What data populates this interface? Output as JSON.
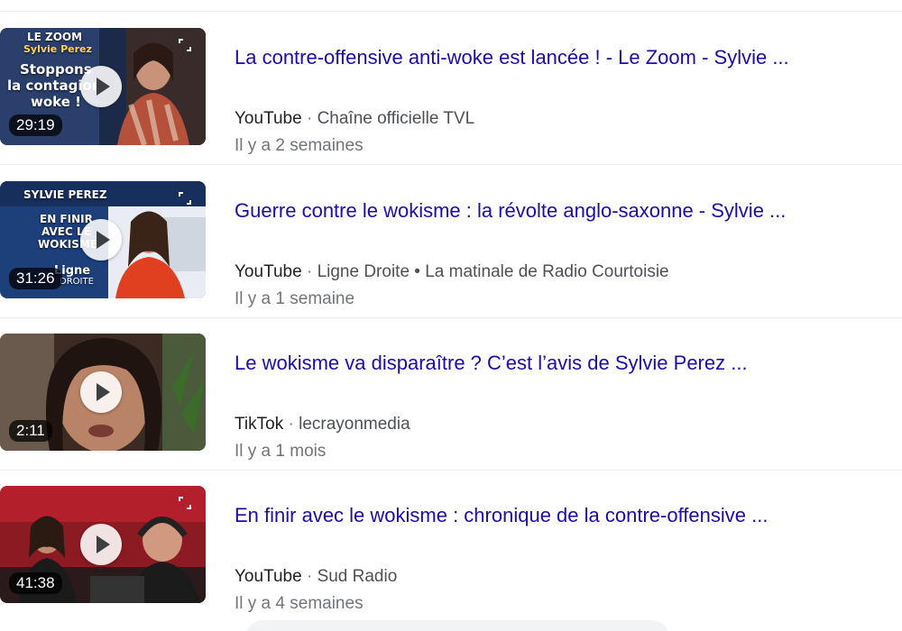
{
  "results": [
    {
      "title": "La contre-offensive anti-woke est lancée ! - Le Zoom - Sylvie ...",
      "source": "YouTube",
      "channel": "Chaîne officielle TVL",
      "date": "Il y a 2 semaines",
      "duration": "29:19",
      "thumb_text": {
        "line1": "LE ZOOM",
        "line2": "Sylvie Perez",
        "line3": "Stoppons",
        "line4": "la contagion",
        "line5": "woke !"
      }
    },
    {
      "title": "Guerre contre le wokisme : la révolte anglo-saxonne - Sylvie ...",
      "source": "YouTube",
      "channel": "Ligne Droite • La matinale de Radio Courtoisie",
      "date": "Il y a 1 semaine",
      "duration": "31:26",
      "thumb_text": {
        "line1": "SYLVIE PEREZ",
        "line2": "EN FINIR",
        "line3": "AVEC LE",
        "line4": "WOKISME",
        "line5": "Ligne",
        "line6": "DROITE"
      }
    },
    {
      "title": "Le wokisme va disparaître ? C’est l’avis de Sylvie Perez ...",
      "source": "TikTok",
      "channel": "lecrayonmedia",
      "date": "Il y a 1 mois",
      "duration": "2:11"
    },
    {
      "title": "En finir avec le wokisme : chronique de la contre-offensive ...",
      "source": "YouTube",
      "channel": "Sud Radio",
      "date": "Il y a 4 semaines",
      "duration": "41:38"
    }
  ],
  "separator": "·",
  "colors": {
    "link": "#1a0dab",
    "meta": "#4d5156",
    "date": "#70757a"
  }
}
